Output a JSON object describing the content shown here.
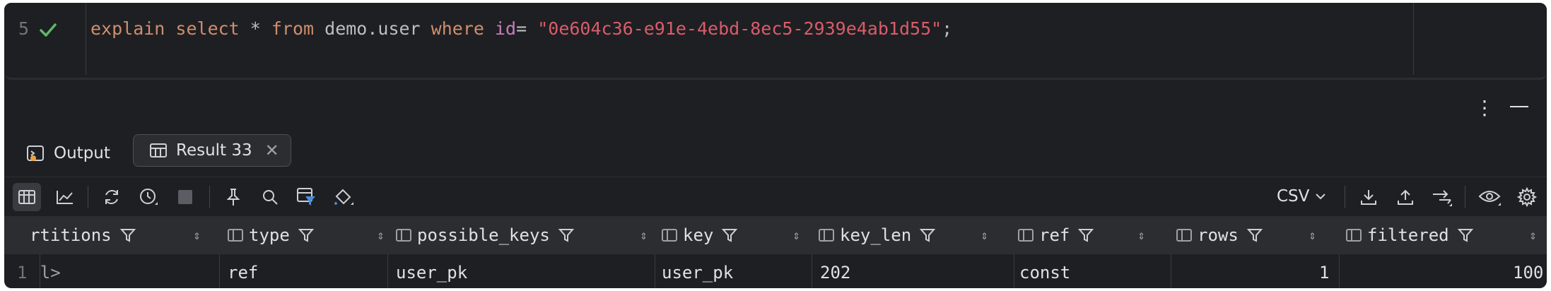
{
  "editor": {
    "line_number": "5",
    "code": {
      "kw1": "explain select",
      "star": " * ",
      "kw2": "from",
      "table": " demo.user ",
      "kw3": "where",
      "sp": " ",
      "col": "id",
      "eq": "= ",
      "str": "\"0e604c36-e91e-4ebd-8ec5-2939e4ab1d55\"",
      "semi": ";"
    }
  },
  "panel": {
    "menu_icon": "⋮"
  },
  "tabs": [
    {
      "label": "Output",
      "icon": "console-icon"
    },
    {
      "label": "Result 33",
      "icon": "table-icon",
      "close": "✕"
    }
  ],
  "toolbar": {
    "export_format": "CSV"
  },
  "table": {
    "columns": [
      "rtitions",
      "type",
      "possible_keys",
      "key",
      "key_len",
      "ref",
      "rows",
      "filtered"
    ],
    "rows": [
      {
        "num": "1",
        "partitions": "<null>",
        "type": "ref",
        "possible_keys": "user_pk",
        "key": "user_pk",
        "key_len": "202",
        "ref": "const",
        "rows": "1",
        "filtered": "100"
      }
    ]
  },
  "colors": {
    "background": "#1e1f22",
    "header_bg": "#2b2d30",
    "keyword": "#cf8e6d",
    "string": "#d95c6b",
    "check": "#5fb865"
  }
}
